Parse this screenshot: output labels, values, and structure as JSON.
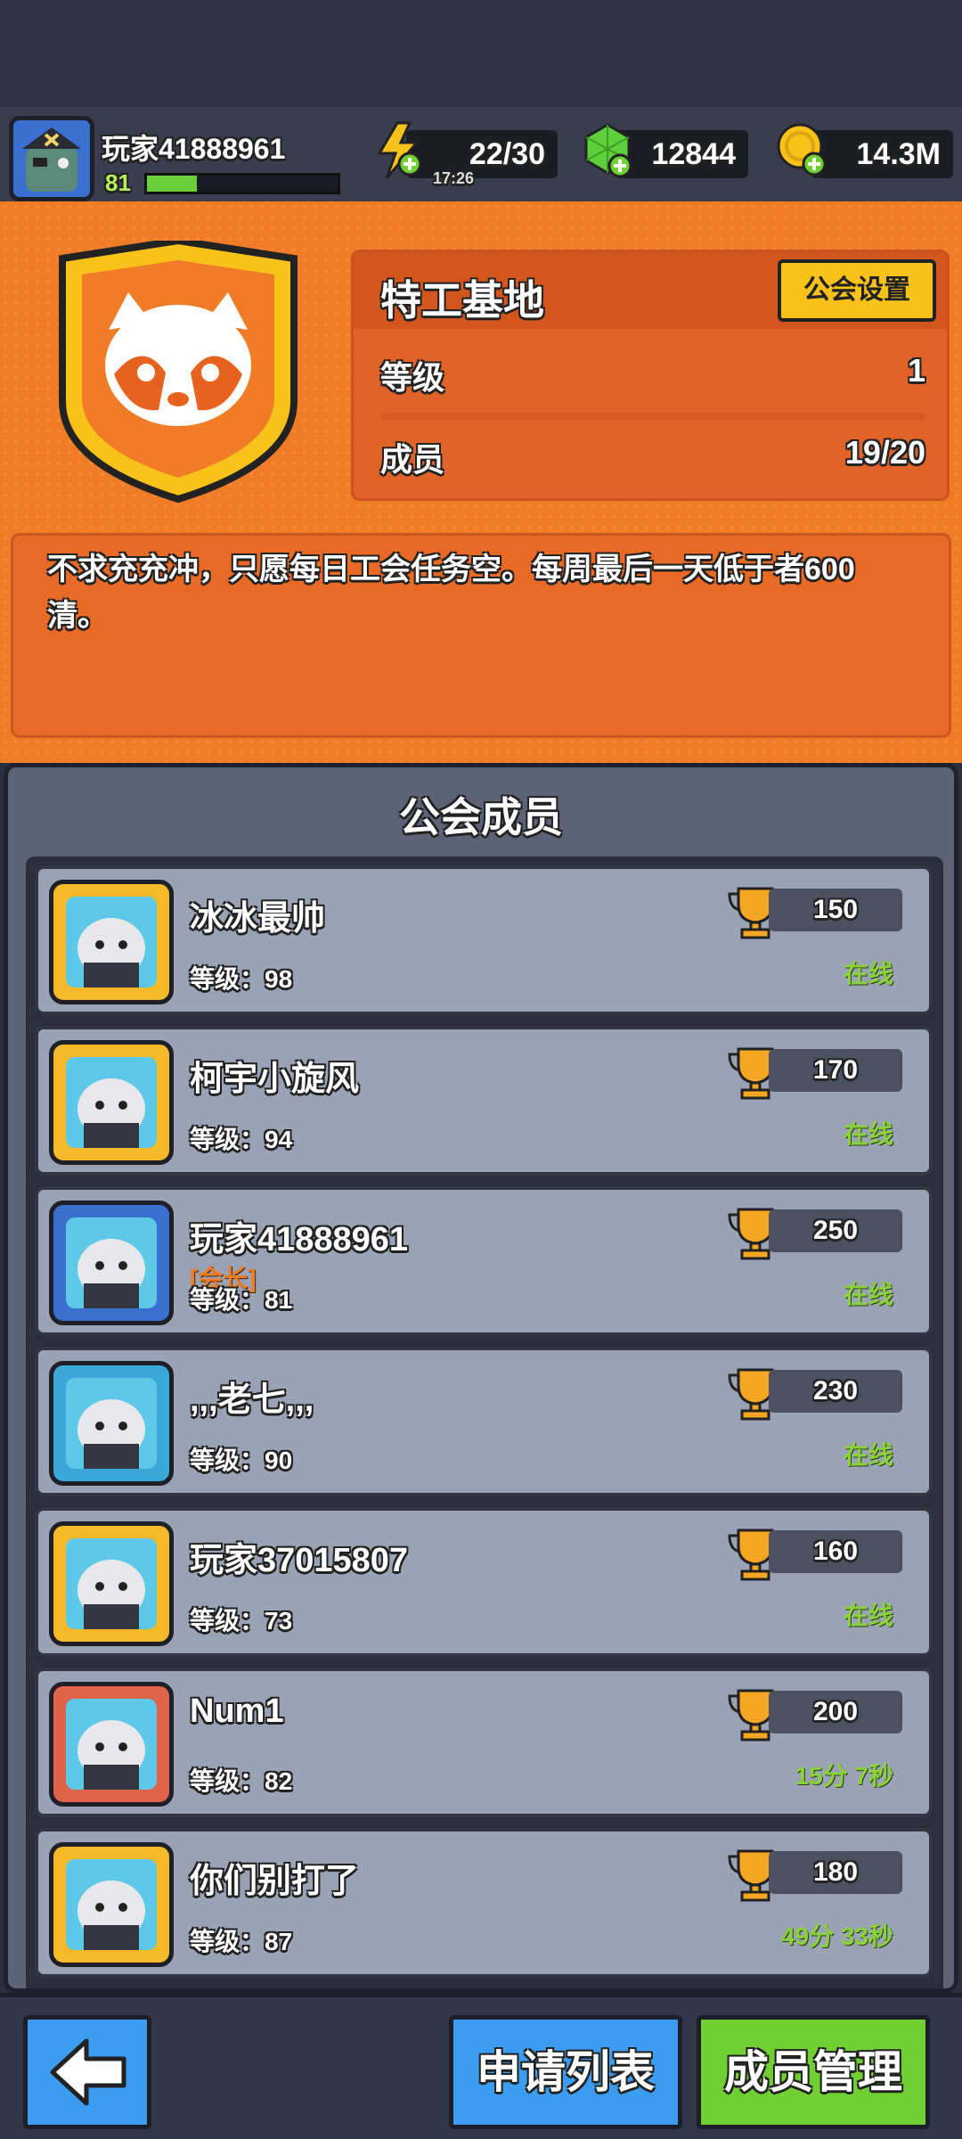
{
  "player": {
    "name": "玩家41888961",
    "level": "81",
    "xp_fraction": 0.26
  },
  "resources": {
    "energy": {
      "value": "22/30",
      "timer": "17:26",
      "icon": "lightning-icon"
    },
    "gems": {
      "value": "12844",
      "icon": "gem-icon"
    },
    "coins": {
      "value": "14.3M",
      "icon": "coin-icon"
    }
  },
  "guild": {
    "name": "特工基地",
    "settings_label": "公会设置",
    "level_label": "等级",
    "level_value": "1",
    "members_label": "成员",
    "members_value": "19/20",
    "emblem_icon": "red-panda-icon",
    "description": "不求充充冲，只愿每日工会任务空。每周最后一天低于者600清。"
  },
  "members_panel": {
    "title": "公会成员",
    "members": [
      {
        "name": "冰冰最帅",
        "role": "",
        "level": "等级：98",
        "score": "150",
        "status": "在线",
        "avatar_color": "#f5b92a"
      },
      {
        "name": "柯宇小旋风",
        "role": "",
        "level": "等级：94",
        "score": "170",
        "status": "在线",
        "avatar_color": "#f5b92a"
      },
      {
        "name": "玩家41888961",
        "role": "[会长]",
        "level": "等级：81",
        "score": "250",
        "status": "在线",
        "avatar_color": "#3b6fd0"
      },
      {
        "name": ",,,老七,,,",
        "role": "",
        "level": "等级：90",
        "score": "230",
        "status": "在线",
        "avatar_color": "#3aa8d8"
      },
      {
        "name": "玩家37015807",
        "role": "",
        "level": "等级：73",
        "score": "160",
        "status": "在线",
        "avatar_color": "#f5b92a"
      },
      {
        "name": "Num1",
        "role": "",
        "level": "等级：82",
        "score": "200",
        "status": "15分 7秒",
        "avatar_color": "#e0644a"
      },
      {
        "name": "你们别打了",
        "role": "",
        "level": "等级：87",
        "score": "180",
        "status": "49分 33秒",
        "avatar_color": "#f5b92a"
      }
    ]
  },
  "bottom": {
    "apply_label": "申请列表",
    "manage_label": "成员管理",
    "back_icon": "back-arrow-icon"
  }
}
